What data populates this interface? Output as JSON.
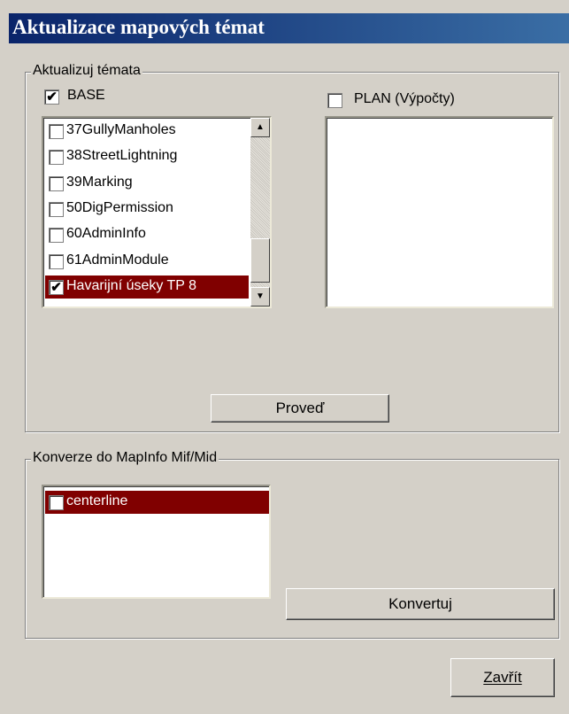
{
  "window": {
    "title": "Aktualizace mapových témat"
  },
  "update_group": {
    "legend": "Aktualizuj témata",
    "base": {
      "label": "BASE",
      "checked": true
    },
    "plan": {
      "label": "PLAN (Výpočty)",
      "checked": false
    },
    "base_items": [
      {
        "label": "37GullyManholes",
        "checked": false
      },
      {
        "label": "38StreetLightning",
        "checked": false
      },
      {
        "label": "39Marking",
        "checked": false
      },
      {
        "label": "50DigPermission",
        "checked": false
      },
      {
        "label": "60AdminInfo",
        "checked": false
      },
      {
        "label": "61AdminModule",
        "checked": false
      },
      {
        "label": "Havarijní úseky TP 8",
        "checked": true,
        "selected": true
      }
    ],
    "execute_button": "Proveď"
  },
  "convert_group": {
    "legend": "Konverze do MapInfo Mif/Mid",
    "items": [
      {
        "label": "centerline",
        "checked": false,
        "selected": true
      }
    ],
    "convert_button": "Konvertuj"
  },
  "close_button": "Zavřít",
  "colors": {
    "title_start": "#0a246a",
    "title_end": "#3a6ea5",
    "selection": "#800000",
    "face": "#d4d0c8"
  }
}
